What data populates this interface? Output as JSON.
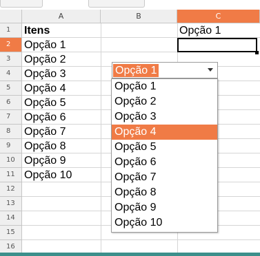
{
  "columns": [
    "A",
    "B",
    "C"
  ],
  "active_column": "C",
  "row_numbers": [
    "1",
    "2",
    "3",
    "4",
    "5",
    "6",
    "7",
    "8",
    "9",
    "10",
    "11",
    "12",
    "13",
    "14",
    "15",
    "16"
  ],
  "active_row": "2",
  "cells": {
    "A1": "Itens",
    "A2": "Opção 1",
    "A3": "Opção 2",
    "A4": "Opção 3",
    "A5": "Opção 4",
    "A6": "Opção 5",
    "A7": "Opção 6",
    "A8": "Opção 7",
    "A9": "Opção 8",
    "A10": "Opção 9",
    "A11": "Opção 10",
    "C1": "Opção 1"
  },
  "dropdown": {
    "selected_value": "Opção 1",
    "options": [
      "Opção 1",
      "Opção 2",
      "Opção 3",
      "Opção 4",
      "Opção 5",
      "Opção 6",
      "Opção 7",
      "Opção 8",
      "Opção 9",
      "Opção 10"
    ],
    "highlighted_option": "Opção 4"
  },
  "colors": {
    "accent": "#f07b46",
    "header_bg": "#efefef",
    "gridline": "#d5d5d5",
    "status_bar": "#3c8f8b"
  }
}
